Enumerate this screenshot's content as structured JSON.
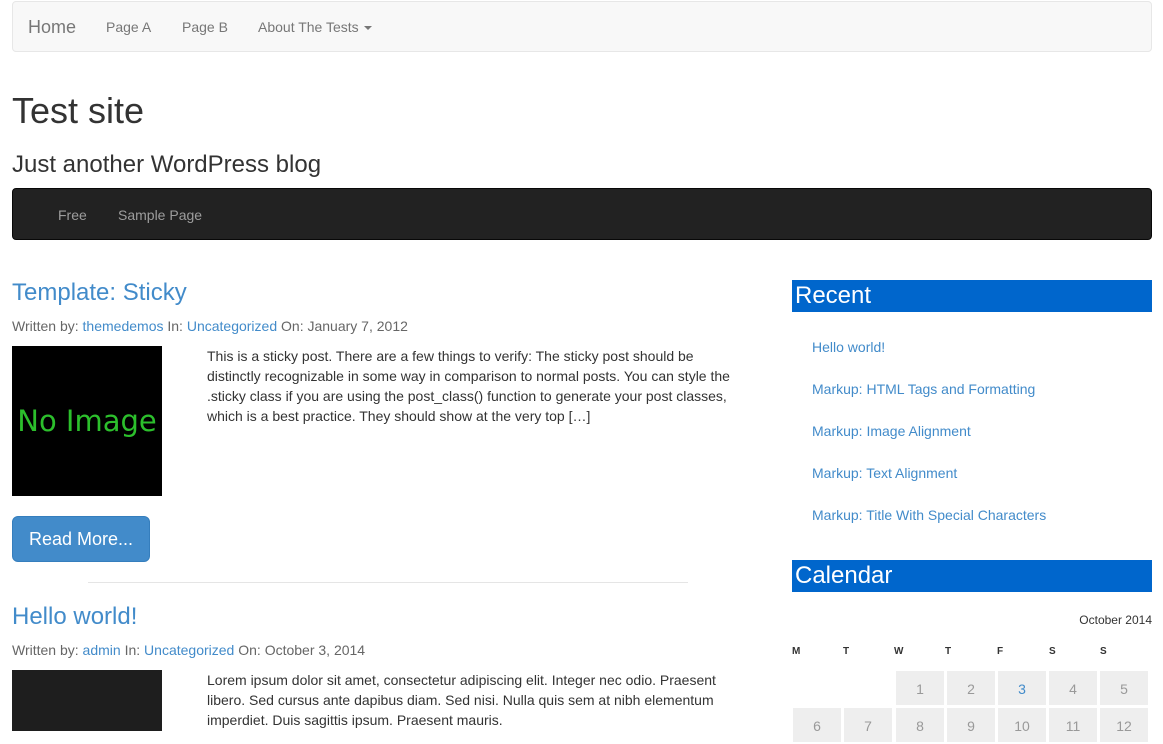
{
  "topnav": {
    "brand": "Home",
    "links": [
      "Page A",
      "Page B",
      "About The Tests"
    ]
  },
  "site": {
    "title": "Test site",
    "description": "Just another WordPress blog"
  },
  "darknav": {
    "links": [
      "Free",
      "Sample Page"
    ]
  },
  "posts": [
    {
      "title": "Template: Sticky",
      "meta": {
        "written_by": "Written by:",
        "author": "themedemos",
        "in": "In:",
        "category": "Uncategorized",
        "on": "On:",
        "date": "January 7, 2012"
      },
      "thumb_text": "No Image",
      "excerpt": "This is a sticky post. There are a few things to verify: The sticky post should be distinctly recognizable in some way in comparison to normal posts. You can style the .sticky class if you are using the post_class() function to generate your post classes, which is a best practice. They should show at the very top […]",
      "read_more": "Read More..."
    },
    {
      "title": "Hello world!",
      "meta": {
        "written_by": "Written by:",
        "author": "admin",
        "in": "In:",
        "category": "Uncategorized",
        "on": "On:",
        "date": "October 3, 2014"
      },
      "thumb_text": "",
      "excerpt": "Lorem ipsum dolor sit amet, consectetur adipiscing elit. Integer nec odio. Praesent libero. Sed cursus ante dapibus diam. Sed nisi. Nulla quis sem at nibh elementum imperdiet. Duis sagittis ipsum. Praesent mauris."
    }
  ],
  "sidebar": {
    "recent_title": "Recent",
    "recent_links": [
      "Hello world!",
      "Markup: HTML Tags and Formatting",
      "Markup: Image Alignment",
      "Markup: Text Alignment",
      "Markup: Title With Special Characters"
    ],
    "calendar_title": "Calendar",
    "calendar": {
      "caption": "October 2014",
      "headers": [
        "M",
        "T",
        "W",
        "T",
        "F",
        "S",
        "S"
      ],
      "row1": [
        "1",
        "2",
        "3",
        "4",
        "5"
      ],
      "row2": [
        "6",
        "7",
        "8",
        "9",
        "10",
        "11",
        "12"
      ],
      "today": "3"
    }
  },
  "colors": {
    "link": "#428bca",
    "widget_header": "#0066cc",
    "dark_nav": "#222222"
  }
}
